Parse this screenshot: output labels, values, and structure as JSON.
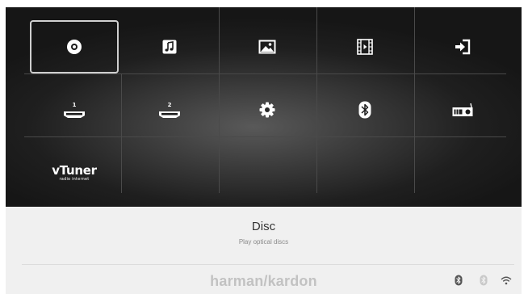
{
  "menu": {
    "tiles": [
      {
        "id": "disc",
        "icon": "disc-icon",
        "selected": true
      },
      {
        "id": "music",
        "icon": "music-note-icon"
      },
      {
        "id": "photos",
        "icon": "picture-icon"
      },
      {
        "id": "video",
        "icon": "film-icon"
      },
      {
        "id": "input",
        "icon": "input-icon"
      },
      {
        "id": "hdmi1",
        "icon": "hdmi-1-icon",
        "label": "1"
      },
      {
        "id": "hdmi2",
        "icon": "hdmi-2-icon",
        "label": "2"
      },
      {
        "id": "settings",
        "icon": "gear-icon"
      },
      {
        "id": "bluetooth",
        "icon": "bluetooth-icon"
      },
      {
        "id": "radio",
        "icon": "radio-icon"
      },
      {
        "id": "vtuner",
        "icon": "vtuner-logo",
        "logo_text": "vTuner",
        "logo_subtext": "radio internet"
      }
    ]
  },
  "info": {
    "title": "Disc",
    "subtitle": "Play optical discs"
  },
  "footer": {
    "brand": "harman/kardon",
    "status_icons": [
      "bluetooth-icon",
      "bluetooth-icon",
      "wifi-icon"
    ]
  },
  "colors": {
    "menu_bg": "#1c1c1c",
    "panel_bg": "#f0f0f0",
    "icon": "#ffffff",
    "brand": "#c2c2c2"
  }
}
